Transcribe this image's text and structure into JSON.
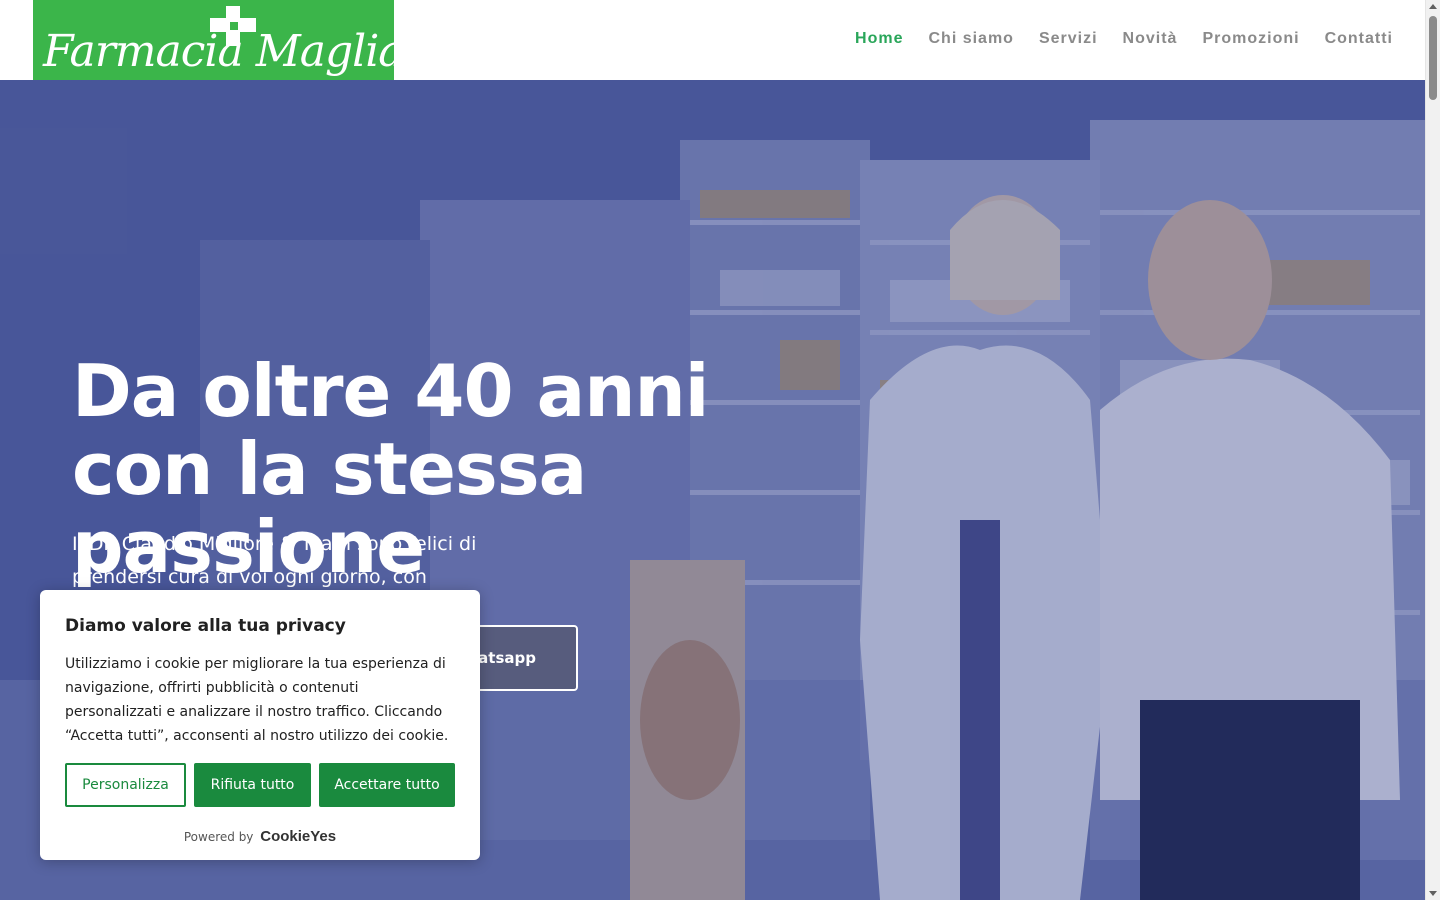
{
  "header": {
    "logo_text": "Farmacia Magliaso",
    "logo_color": "#3bb54a",
    "nav": [
      {
        "label": "Home",
        "active": true
      },
      {
        "label": "Chi siamo",
        "active": false
      },
      {
        "label": "Servizi",
        "active": false
      },
      {
        "label": "Novità",
        "active": false
      },
      {
        "label": "Promozioni",
        "active": false
      },
      {
        "label": "Contatti",
        "active": false
      }
    ]
  },
  "hero": {
    "title": "Da oltre 40 anni con la stessa passione",
    "subtitle": "Il Dr. Claudio Migliore & Team sono felici di prendersi cura di voi ogni giorno, con professionalità e attenzione.",
    "whatsapp_button": "Whatsapp",
    "whatsapp_button_visible": "hatsapp"
  },
  "cookie": {
    "title": "Diamo valore alla tua privacy",
    "text": "Utilizziamo i cookie per migliorare la tua esperienza di navigazione, offrirti pubblicità o contenuti personalizzati e analizzare il nostro traffico. Cliccando “Accetta tutti”, acconsenti al nostro utilizzo dei cookie.",
    "customize": "Personalizza",
    "reject": "Rifiuta tutto",
    "accept": "Accettare tutto",
    "powered_by": "Powered by",
    "brand": "CookieYes",
    "accent_color": "#1a8a3e"
  },
  "colors": {
    "nav_active": "#2aa65a",
    "nav_default": "#8a8a8a"
  }
}
